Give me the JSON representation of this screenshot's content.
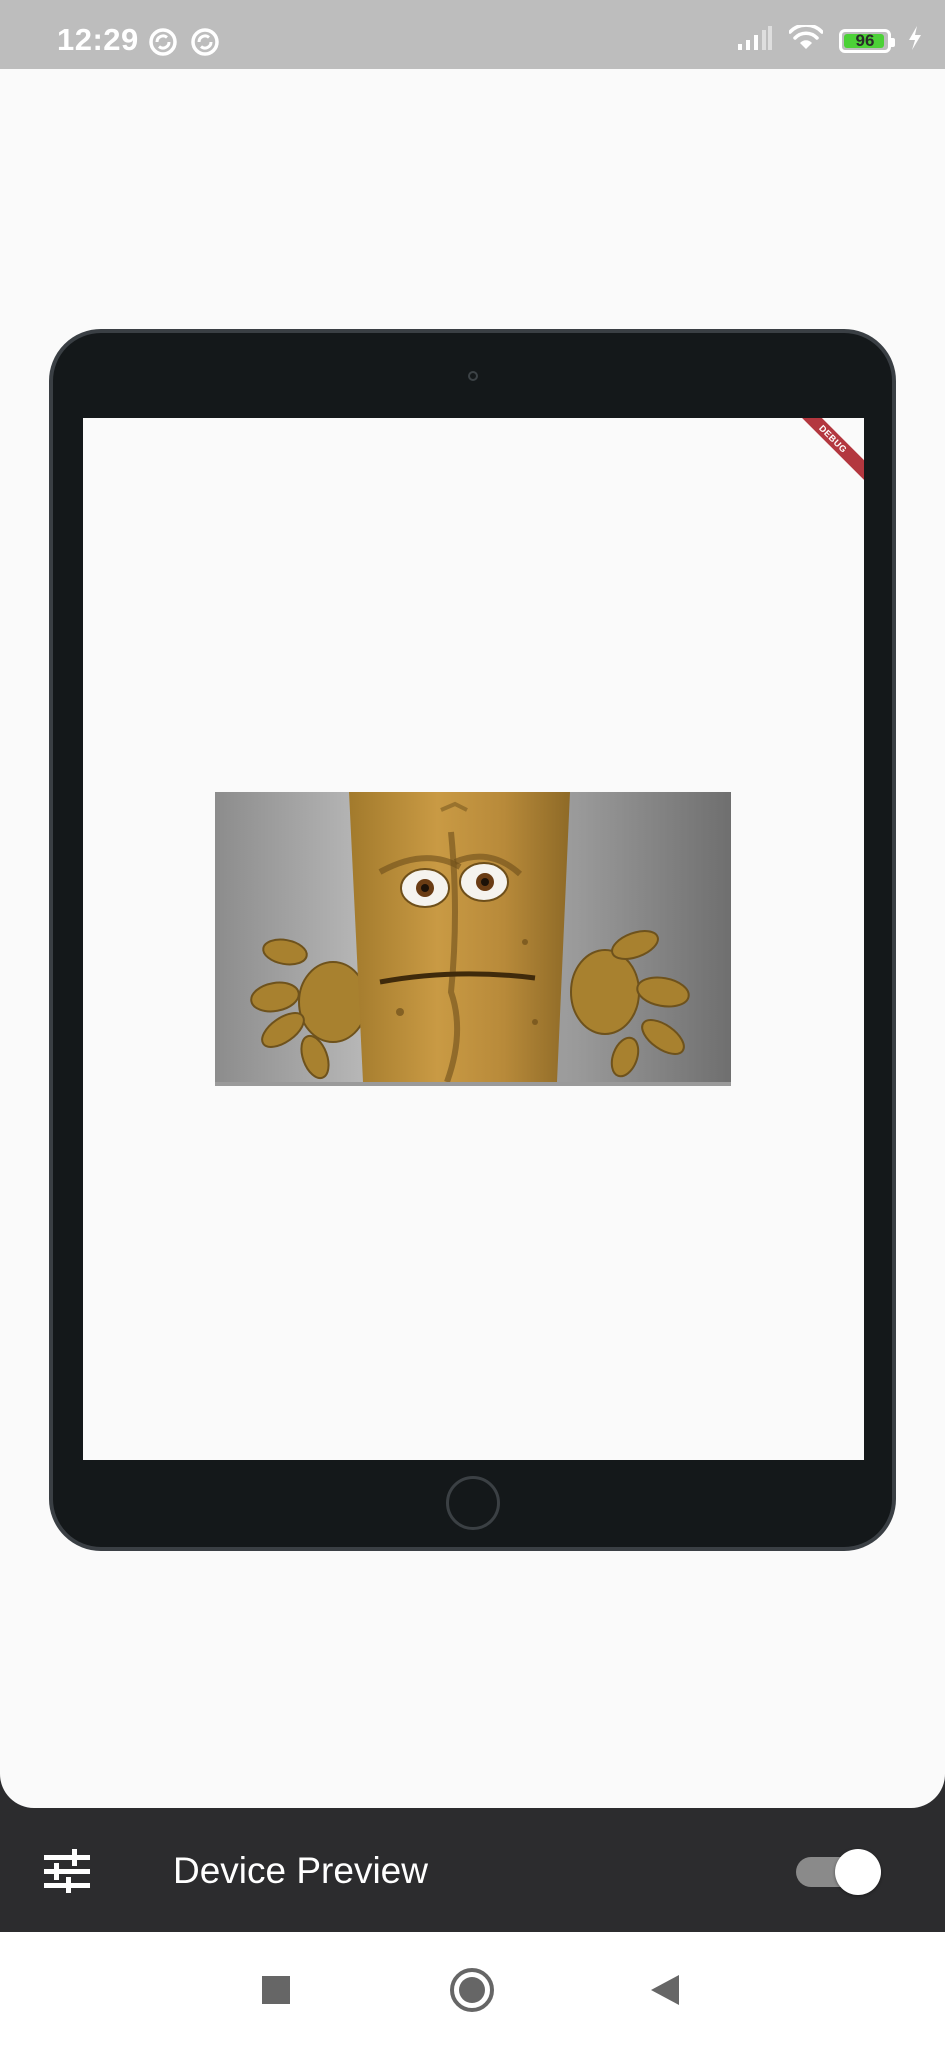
{
  "status_bar": {
    "time": "12:29",
    "battery_level": "96",
    "battery_fraction": 0.96,
    "left_icons": [
      "sync-icon",
      "sync-icon"
    ],
    "right_icons": [
      "signal-icon",
      "wifi-icon",
      "battery-icon",
      "charging-icon"
    ]
  },
  "device_frame": {
    "model": "tablet",
    "debug_banner": "DEBUG"
  },
  "bottom_bar": {
    "menu_icon": "tune-icon",
    "title": "Device Preview",
    "toggle_enabled": true
  },
  "nav_bar": {
    "icons": [
      "recents-icon",
      "home-icon",
      "back-icon"
    ]
  },
  "colors": {
    "status_bar": "#bdbdbd",
    "app_background": "#fafafa",
    "tablet_frame": "#14181a",
    "bottom_bar": "#2c2c2e",
    "battery_fill": "#4cd137",
    "debug_ribbon": "#b3373f"
  }
}
